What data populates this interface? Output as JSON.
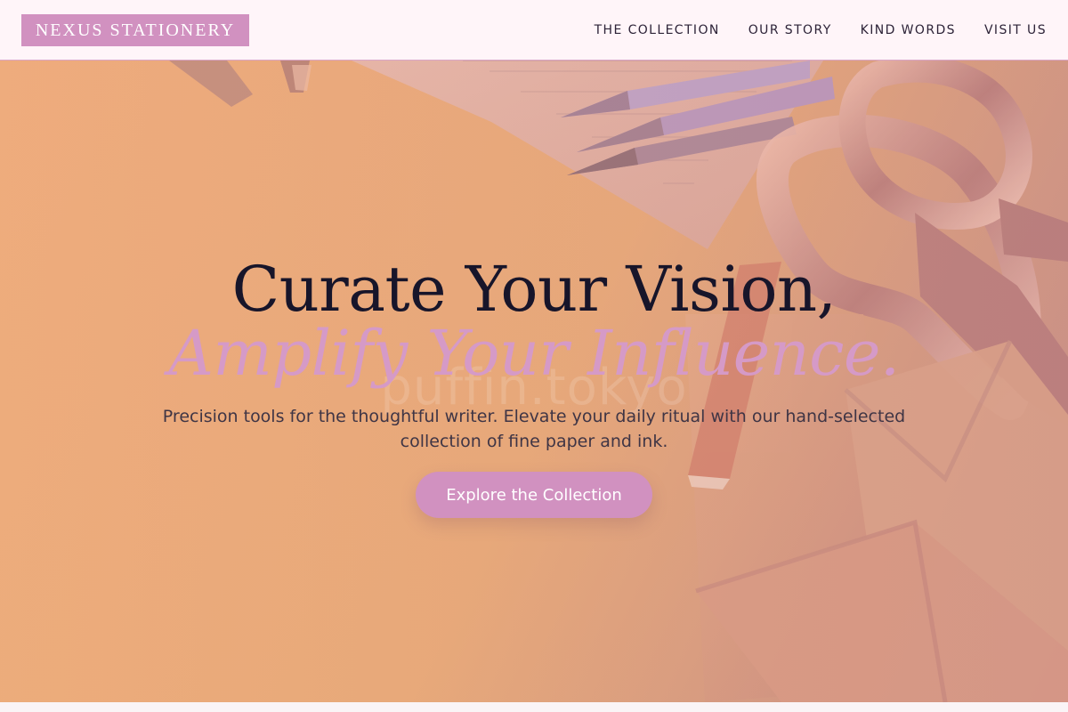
{
  "brand": {
    "name": "NEXUS STATIONERY"
  },
  "nav": {
    "items": [
      {
        "label": "THE COLLECTION"
      },
      {
        "label": "OUR STORY"
      },
      {
        "label": "KIND WORDS"
      },
      {
        "label": "VISIT US"
      }
    ]
  },
  "hero": {
    "headline_line_one": "Curate Your Vision,",
    "headline_line_two": "Amplify Your Influence.",
    "watermark": "puffin.tokyo",
    "subtitle": "Precision tools for the thoughtful writer. Elevate your daily ritual with our hand-selected collection of fine paper and ink.",
    "cta_label": "Explore the Collection"
  },
  "colors": {
    "accent": "#d191c0",
    "header_background": "#fff5f9",
    "hero_background": "#e8aa76",
    "text_dark": "#17152a"
  },
  "icons": {
    "scissors": "scissors-icon",
    "pencils": "pencils-icon",
    "envelope": "envelope-icon",
    "notebook": "notebook-icon"
  }
}
